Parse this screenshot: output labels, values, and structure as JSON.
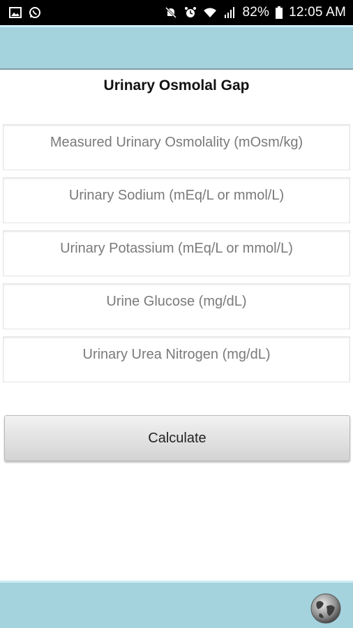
{
  "status_bar": {
    "left_icons": [
      "gallery-icon",
      "whatsapp-icon"
    ],
    "right_icons": [
      "mute-icon",
      "alarm-icon",
      "wifi-icon",
      "signal-icon",
      "battery-icon"
    ],
    "battery": "82%",
    "time": "12:05 AM"
  },
  "page": {
    "title": "Urinary Osmolal Gap"
  },
  "fields": [
    {
      "placeholder": "Measured Urinary Osmolality (mOsm/kg)",
      "value": ""
    },
    {
      "placeholder": "Urinary Sodium (mEq/L or mmol/L)",
      "value": ""
    },
    {
      "placeholder": "Urinary Potassium (mEq/L or mmol/L)",
      "value": ""
    },
    {
      "placeholder": "Urine Glucose (mg/dL)",
      "value": ""
    },
    {
      "placeholder": "Urinary Urea Nitrogen (mg/dL)",
      "value": ""
    }
  ],
  "calculate_label": "Calculate",
  "bottom_bar": {
    "icon": "globe-icon"
  },
  "colors": {
    "header": "#a4d3de",
    "status_bar": "#000000",
    "button": "#dcdcdc"
  }
}
